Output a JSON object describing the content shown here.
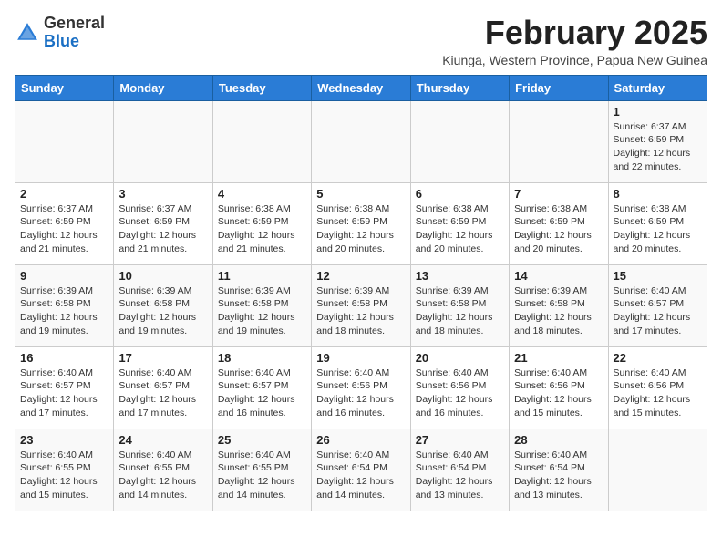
{
  "header": {
    "logo": {
      "general": "General",
      "blue": "Blue"
    },
    "month_year": "February 2025",
    "location": "Kiunga, Western Province, Papua New Guinea"
  },
  "days_of_week": [
    "Sunday",
    "Monday",
    "Tuesday",
    "Wednesday",
    "Thursday",
    "Friday",
    "Saturday"
  ],
  "weeks": [
    [
      {
        "day": "",
        "info": ""
      },
      {
        "day": "",
        "info": ""
      },
      {
        "day": "",
        "info": ""
      },
      {
        "day": "",
        "info": ""
      },
      {
        "day": "",
        "info": ""
      },
      {
        "day": "",
        "info": ""
      },
      {
        "day": "1",
        "info": "Sunrise: 6:37 AM\nSunset: 6:59 PM\nDaylight: 12 hours and 22 minutes."
      }
    ],
    [
      {
        "day": "2",
        "info": "Sunrise: 6:37 AM\nSunset: 6:59 PM\nDaylight: 12 hours and 21 minutes."
      },
      {
        "day": "3",
        "info": "Sunrise: 6:37 AM\nSunset: 6:59 PM\nDaylight: 12 hours and 21 minutes."
      },
      {
        "day": "4",
        "info": "Sunrise: 6:38 AM\nSunset: 6:59 PM\nDaylight: 12 hours and 21 minutes."
      },
      {
        "day": "5",
        "info": "Sunrise: 6:38 AM\nSunset: 6:59 PM\nDaylight: 12 hours and 20 minutes."
      },
      {
        "day": "6",
        "info": "Sunrise: 6:38 AM\nSunset: 6:59 PM\nDaylight: 12 hours and 20 minutes."
      },
      {
        "day": "7",
        "info": "Sunrise: 6:38 AM\nSunset: 6:59 PM\nDaylight: 12 hours and 20 minutes."
      },
      {
        "day": "8",
        "info": "Sunrise: 6:38 AM\nSunset: 6:59 PM\nDaylight: 12 hours and 20 minutes."
      }
    ],
    [
      {
        "day": "9",
        "info": "Sunrise: 6:39 AM\nSunset: 6:58 PM\nDaylight: 12 hours and 19 minutes."
      },
      {
        "day": "10",
        "info": "Sunrise: 6:39 AM\nSunset: 6:58 PM\nDaylight: 12 hours and 19 minutes."
      },
      {
        "day": "11",
        "info": "Sunrise: 6:39 AM\nSunset: 6:58 PM\nDaylight: 12 hours and 19 minutes."
      },
      {
        "day": "12",
        "info": "Sunrise: 6:39 AM\nSunset: 6:58 PM\nDaylight: 12 hours and 18 minutes."
      },
      {
        "day": "13",
        "info": "Sunrise: 6:39 AM\nSunset: 6:58 PM\nDaylight: 12 hours and 18 minutes."
      },
      {
        "day": "14",
        "info": "Sunrise: 6:39 AM\nSunset: 6:58 PM\nDaylight: 12 hours and 18 minutes."
      },
      {
        "day": "15",
        "info": "Sunrise: 6:40 AM\nSunset: 6:57 PM\nDaylight: 12 hours and 17 minutes."
      }
    ],
    [
      {
        "day": "16",
        "info": "Sunrise: 6:40 AM\nSunset: 6:57 PM\nDaylight: 12 hours and 17 minutes."
      },
      {
        "day": "17",
        "info": "Sunrise: 6:40 AM\nSunset: 6:57 PM\nDaylight: 12 hours and 17 minutes."
      },
      {
        "day": "18",
        "info": "Sunrise: 6:40 AM\nSunset: 6:57 PM\nDaylight: 12 hours and 16 minutes."
      },
      {
        "day": "19",
        "info": "Sunrise: 6:40 AM\nSunset: 6:56 PM\nDaylight: 12 hours and 16 minutes."
      },
      {
        "day": "20",
        "info": "Sunrise: 6:40 AM\nSunset: 6:56 PM\nDaylight: 12 hours and 16 minutes."
      },
      {
        "day": "21",
        "info": "Sunrise: 6:40 AM\nSunset: 6:56 PM\nDaylight: 12 hours and 15 minutes."
      },
      {
        "day": "22",
        "info": "Sunrise: 6:40 AM\nSunset: 6:56 PM\nDaylight: 12 hours and 15 minutes."
      }
    ],
    [
      {
        "day": "23",
        "info": "Sunrise: 6:40 AM\nSunset: 6:55 PM\nDaylight: 12 hours and 15 minutes."
      },
      {
        "day": "24",
        "info": "Sunrise: 6:40 AM\nSunset: 6:55 PM\nDaylight: 12 hours and 14 minutes."
      },
      {
        "day": "25",
        "info": "Sunrise: 6:40 AM\nSunset: 6:55 PM\nDaylight: 12 hours and 14 minutes."
      },
      {
        "day": "26",
        "info": "Sunrise: 6:40 AM\nSunset: 6:54 PM\nDaylight: 12 hours and 14 minutes."
      },
      {
        "day": "27",
        "info": "Sunrise: 6:40 AM\nSunset: 6:54 PM\nDaylight: 12 hours and 13 minutes."
      },
      {
        "day": "28",
        "info": "Sunrise: 6:40 AM\nSunset: 6:54 PM\nDaylight: 12 hours and 13 minutes."
      },
      {
        "day": "",
        "info": ""
      }
    ]
  ]
}
